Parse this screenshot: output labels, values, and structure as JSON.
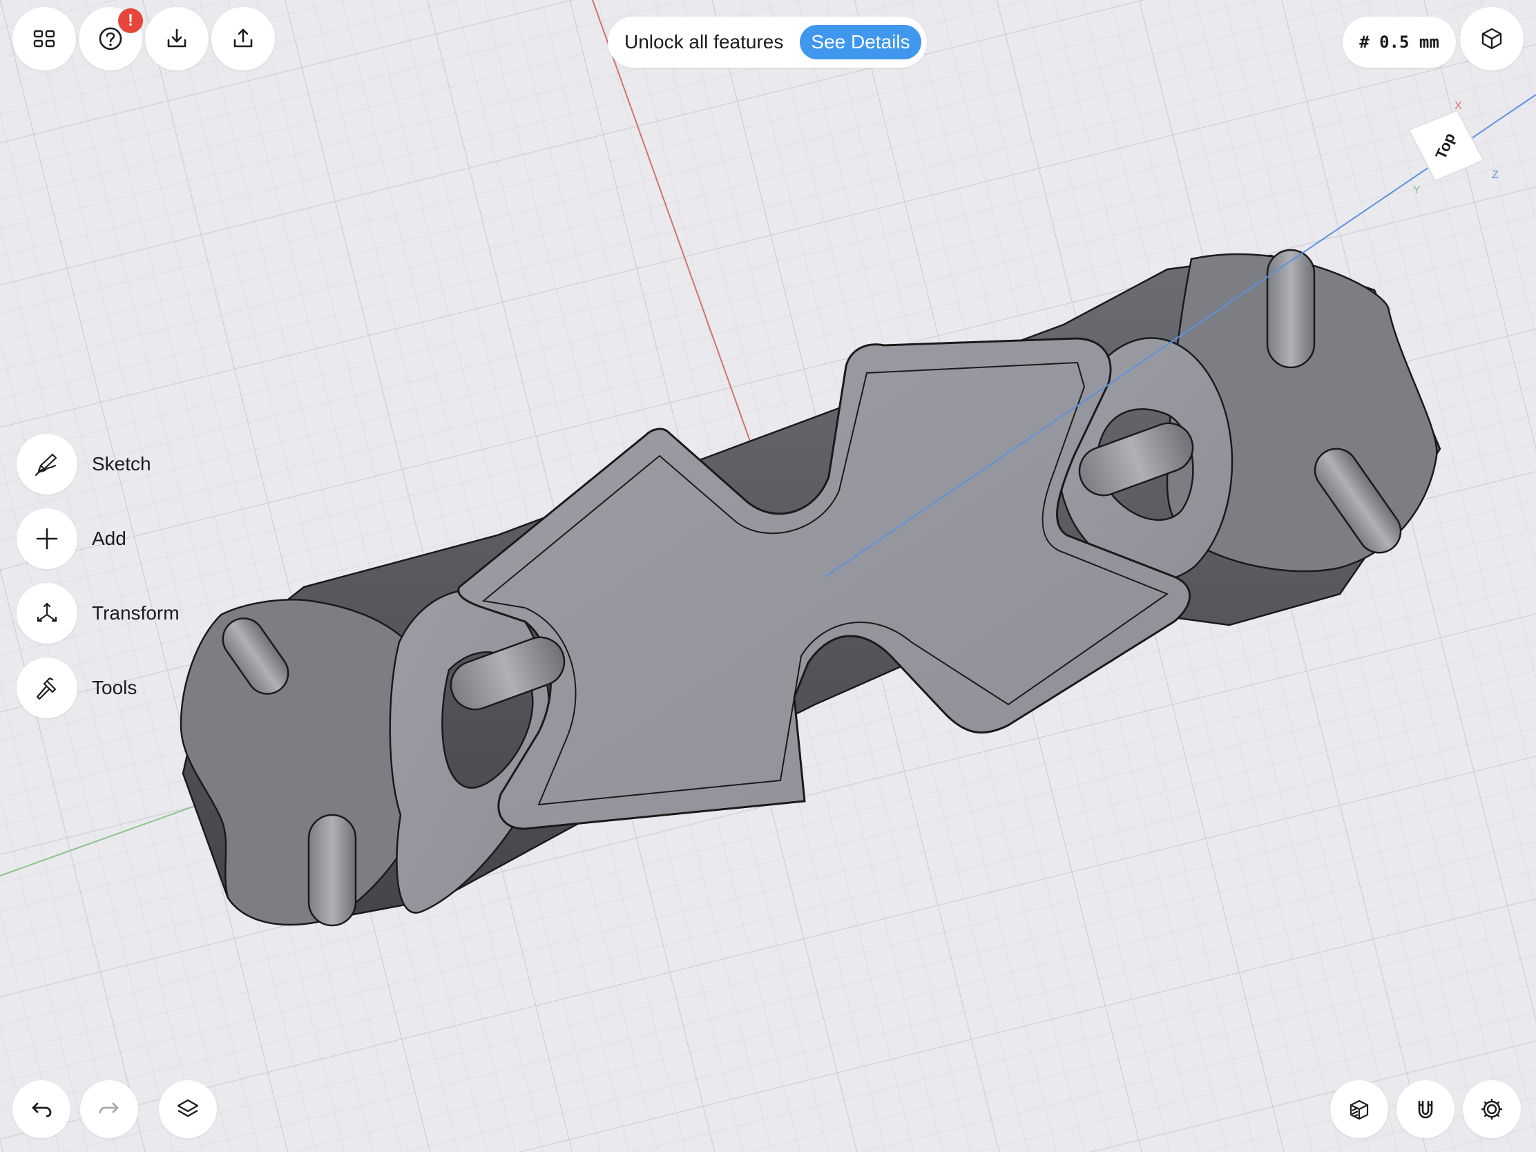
{
  "toolbar": {
    "apps_icon": "grid-icon",
    "help_icon": "help-icon",
    "help_badge": "!",
    "import_icon": "import-icon",
    "export_icon": "export-icon"
  },
  "promo": {
    "text": "Unlock all features",
    "button": "See Details"
  },
  "grid_size": "# 0.5 mm",
  "view_cube": {
    "face_label": "Top",
    "axis_x": "X",
    "axis_y": "Y",
    "axis_z": "Z"
  },
  "side_tools": [
    {
      "label": "Sketch",
      "icon": "sketch-pencil-icon"
    },
    {
      "label": "Add",
      "icon": "plus-icon"
    },
    {
      "label": "Transform",
      "icon": "transform-arrows-icon"
    },
    {
      "label": "Tools",
      "icon": "hammer-icon"
    }
  ],
  "bottom_left": {
    "undo_icon": "undo-icon",
    "redo_icon": "redo-icon",
    "layers_icon": "layers-icon"
  },
  "bottom_right": {
    "material_icon": "section-view-icon",
    "snap_icon": "magnet-icon",
    "settings_icon": "gear-icon"
  },
  "colors": {
    "background": "#e9e9ee",
    "accent": "#3f97ee",
    "badge": "#e5453b",
    "axis_x": "#d2736e",
    "axis_y": "#8dc38c",
    "axis_z": "#5a93e0",
    "model": "#8e8f96"
  }
}
